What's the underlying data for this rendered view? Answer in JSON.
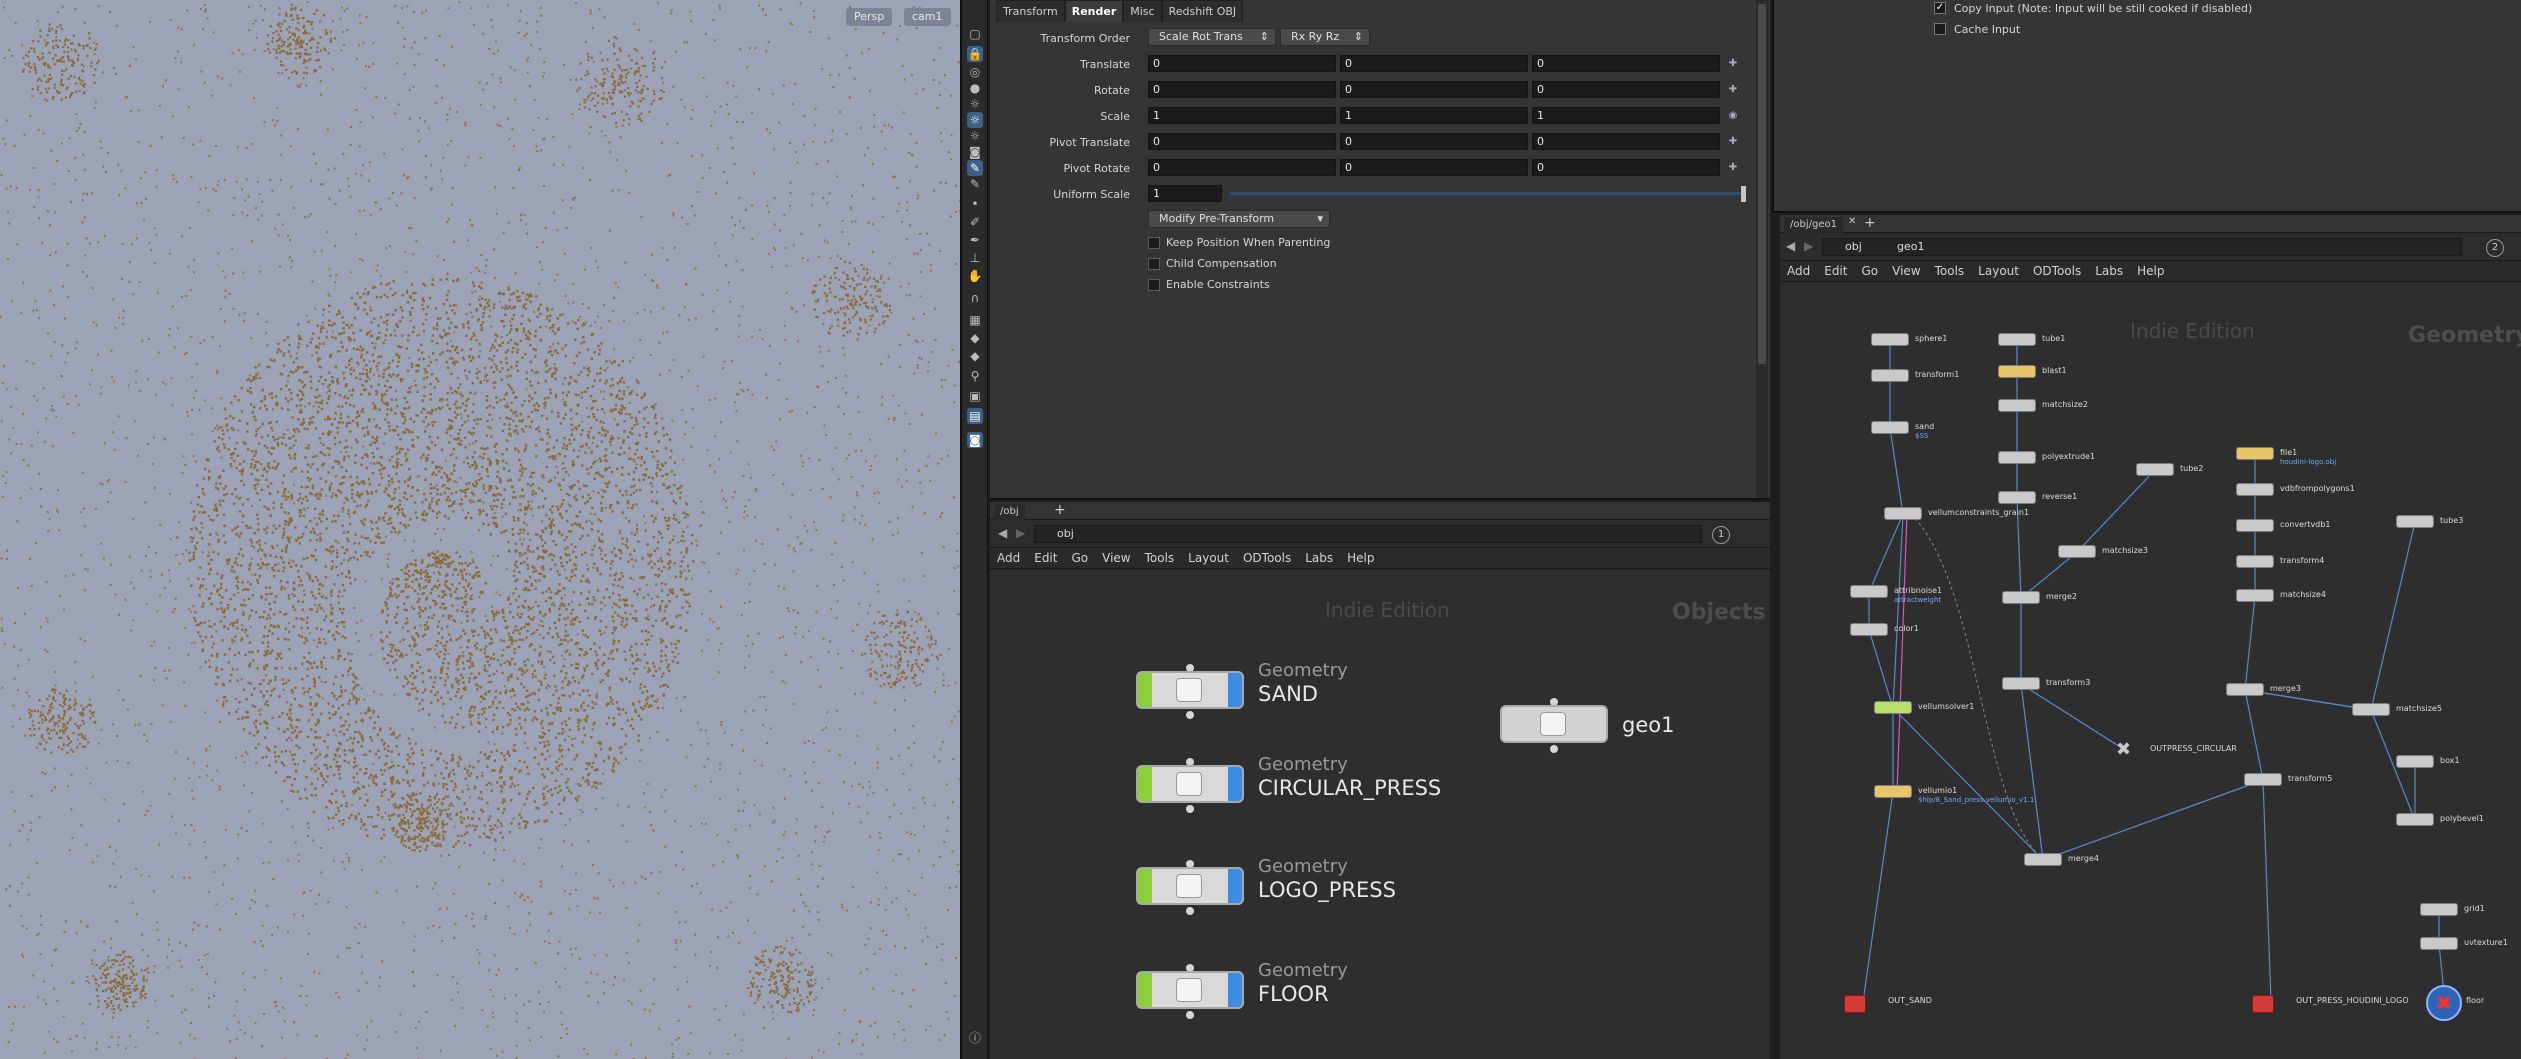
{
  "viewport": {
    "camera_mode": "Persp",
    "camera_name": "cam1",
    "background_color": "#9da3b6",
    "sand_color": "#8a6b3c"
  },
  "viewport_toolbar": {
    "icons": [
      "select-icon",
      "lock-icon",
      "display-icon",
      "sphere-icon",
      "light-icon",
      "light-icon",
      "light-icon",
      "camera-icon",
      "paint-icon",
      "paint-icon",
      "point-icon",
      "brush-icon",
      "pen-icon",
      "ruler-icon",
      "grab-icon",
      "magnet-icon",
      "grid-icon",
      "cube-icon",
      "cube-icon",
      "rig-icon",
      "box-icon",
      "snapshot-icon",
      "camera-icon",
      "info-icon"
    ]
  },
  "parameters": {
    "tabs": [
      "Transform",
      "Render",
      "Misc",
      "Redshift OBJ"
    ],
    "active_tab": "Render",
    "rows": [
      {
        "label": "Transform Order",
        "type": "menus",
        "values": [
          "Scale Rot Trans",
          "Rx Ry Rz"
        ]
      },
      {
        "label": "Translate",
        "values": [
          "0",
          "0",
          "0"
        ]
      },
      {
        "label": "Rotate",
        "values": [
          "0",
          "0",
          "0"
        ]
      },
      {
        "label": "Scale",
        "values": [
          "1",
          "1",
          "1"
        ]
      },
      {
        "label": "Pivot Translate",
        "values": [
          "0",
          "0",
          "0"
        ]
      },
      {
        "label": "Pivot Rotate",
        "values": [
          "0",
          "0",
          "0"
        ]
      },
      {
        "label": "Uniform Scale",
        "values": [
          "1"
        ]
      }
    ],
    "modify_button": "Modify Pre-Transform",
    "checkboxes": [
      "Keep Position When Parenting",
      "Child Compensation",
      "Enable Constraints"
    ]
  },
  "top_right": {
    "checkboxes": [
      {
        "label": "Copy Input (Note: Input will be still cooked if disabled)",
        "checked": true
      },
      {
        "label": "Cache Input",
        "checked": false
      }
    ]
  },
  "obj_network": {
    "tab": "/obj",
    "path": "obj",
    "badge": "1",
    "menu": [
      "Add",
      "Edit",
      "Go",
      "View",
      "Tools",
      "Layout",
      "ODTools",
      "Labs",
      "Help"
    ],
    "watermark": "Indie Edition",
    "context": "Objects",
    "nodes": [
      {
        "type": "Geometry",
        "name": "SAND"
      },
      {
        "type": "Geometry",
        "name": "CIRCULAR_PRESS"
      },
      {
        "type": "Geometry",
        "name": "LOGO_PRESS"
      },
      {
        "type": "Geometry",
        "name": "FLOOR"
      },
      {
        "type": "",
        "name": "geo1"
      }
    ]
  },
  "geo_network": {
    "tab": "/obj/geo1",
    "path_root": "obj",
    "path_node": "geo1",
    "badge": "2",
    "menu": [
      "Add",
      "Edit",
      "Go",
      "View",
      "Tools",
      "Layout",
      "ODTools",
      "Labs",
      "Help"
    ],
    "watermark": "Indie Edition",
    "context": "Geometry",
    "nodes": [
      {
        "name": "sphere1",
        "sub": ""
      },
      {
        "name": "transform1",
        "sub": ""
      },
      {
        "name": "sand",
        "sub": "$SS"
      },
      {
        "name": "vellumconstraints_grain1",
        "sub": ""
      },
      {
        "name": "attribnoise1",
        "sub": "attractweight"
      },
      {
        "name": "color1",
        "sub": ""
      },
      {
        "name": "vellumsolver1",
        "sub": ""
      },
      {
        "name": "vellumio1",
        "sub": "$hip/8_Sand_press.vellumio_v1.1"
      },
      {
        "name": "OUT_SAND",
        "sub": ""
      },
      {
        "name": "tube1",
        "sub": ""
      },
      {
        "name": "blast1",
        "sub": ""
      },
      {
        "name": "matchsize2",
        "sub": ""
      },
      {
        "name": "polyextrude1",
        "sub": ""
      },
      {
        "name": "reverse1",
        "sub": ""
      },
      {
        "name": "tube2",
        "sub": ""
      },
      {
        "name": "matchsize3",
        "sub": ""
      },
      {
        "name": "merge2",
        "sub": ""
      },
      {
        "name": "transform3",
        "sub": ""
      },
      {
        "name": "OUTPRESS_CIRCULAR",
        "sub": ""
      },
      {
        "name": "merge4",
        "sub": ""
      },
      {
        "name": "file1",
        "sub": "houdini-logo.obj"
      },
      {
        "name": "vdbfrompolygons1",
        "sub": ""
      },
      {
        "name": "convertvdb1",
        "sub": ""
      },
      {
        "name": "transform4",
        "sub": ""
      },
      {
        "name": "matchsize4",
        "sub": ""
      },
      {
        "name": "merge3",
        "sub": ""
      },
      {
        "name": "matchsize5",
        "sub": ""
      },
      {
        "name": "transform5",
        "sub": ""
      },
      {
        "name": "OUT_PRESS_HOUDINI_LOGO",
        "sub": ""
      },
      {
        "name": "tube3",
        "sub": ""
      },
      {
        "name": "box1",
        "sub": ""
      },
      {
        "name": "polybevel1",
        "sub": ""
      },
      {
        "name": "grid1",
        "sub": ""
      },
      {
        "name": "uvtexture1",
        "sub": ""
      },
      {
        "name": "floor",
        "sub": ""
      }
    ]
  }
}
